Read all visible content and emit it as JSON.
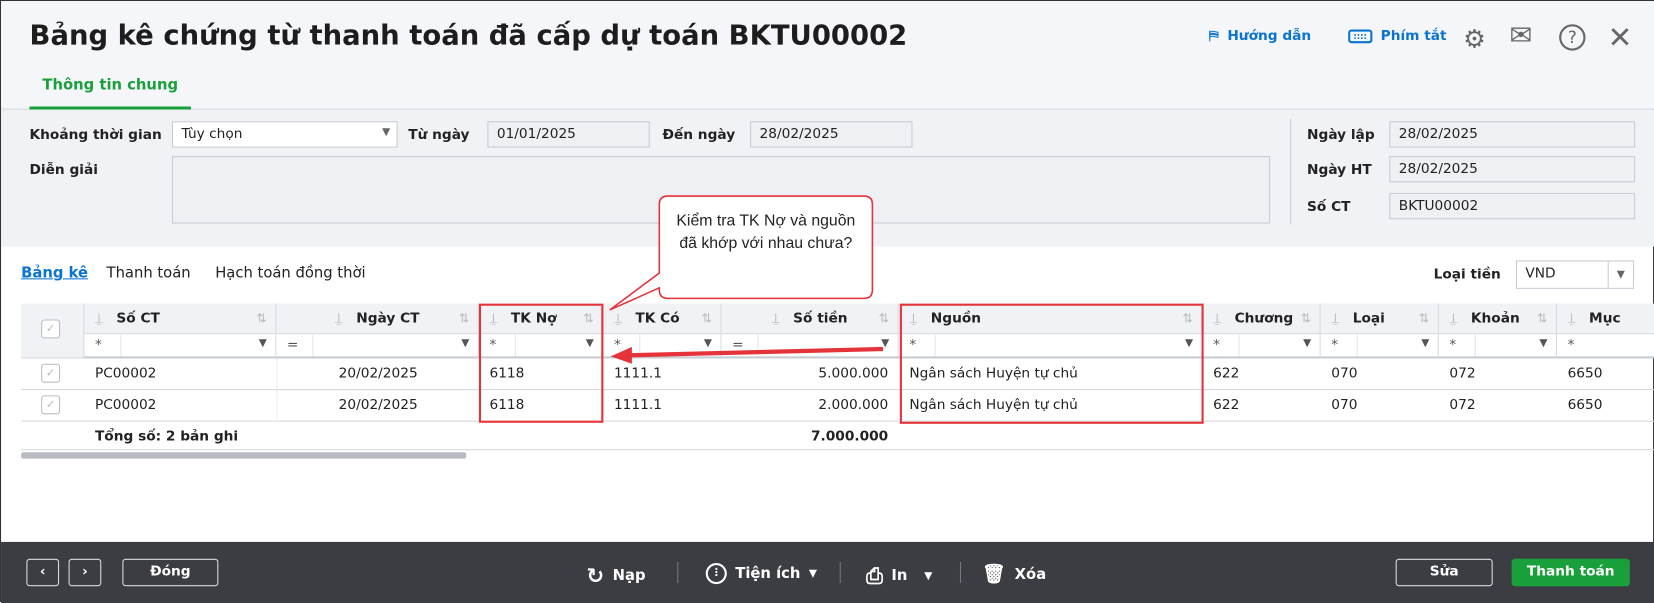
{
  "title": "Bảng kê chứng từ thanh toán đã cấp dự toán BKTU00002",
  "header": {
    "guide": "Hướng dẫn",
    "shortcuts": "Phím tắt"
  },
  "main_tab": "Thông tin chung",
  "form": {
    "period_label": "Khoảng thời gian",
    "period_value": "Tùy chọn",
    "from_label": "Từ ngày",
    "from_value": "01/01/2025",
    "to_label": "Đến ngày",
    "to_value": "28/02/2025",
    "desc_label": "Diễn giải",
    "desc_value": "",
    "created_label": "Ngày lập",
    "created_value": "28/02/2025",
    "ht_label": "Ngày HT",
    "ht_value": "28/02/2025",
    "no_label": "Số CT",
    "no_value": "BKTU00002"
  },
  "subtabs": [
    "Bảng kê",
    "Thanh toán",
    "Hạch toán đồng thời"
  ],
  "currency": {
    "label": "Loại tiền",
    "value": "VND"
  },
  "callout": "Kiểm tra TK Nợ và nguồn đã khớp với nhau chưa?",
  "columns": [
    "Số CT",
    "Ngày CT",
    "TK Nợ",
    "TK Có",
    "Số tiền",
    "Nguồn",
    "Chương",
    "Loại",
    "Khoản",
    "Mục"
  ],
  "filters": [
    "*",
    "=",
    "*",
    "*",
    "=",
    "*",
    "*",
    "*",
    "*",
    "*"
  ],
  "rows": [
    [
      "PC00002",
      "20/02/2025",
      "6118",
      "1111.1",
      "5.000.000",
      "Ngân sách Huyện tự chủ",
      "622",
      "070",
      "072",
      "6650"
    ],
    [
      "PC00002",
      "20/02/2025",
      "6118",
      "1111.1",
      "2.000.000",
      "Ngân sách Huyện tự chủ",
      "622",
      "070",
      "072",
      "6650"
    ]
  ],
  "total_label": "Tổng số: 2 bản ghi",
  "total_amount": "7.000.000",
  "footer": {
    "close": "Đóng",
    "reload": "Nạp",
    "utilities": "Tiện ích",
    "print": "In",
    "delete": "Xóa",
    "edit": "Sửa",
    "pay": "Thanh toán"
  }
}
